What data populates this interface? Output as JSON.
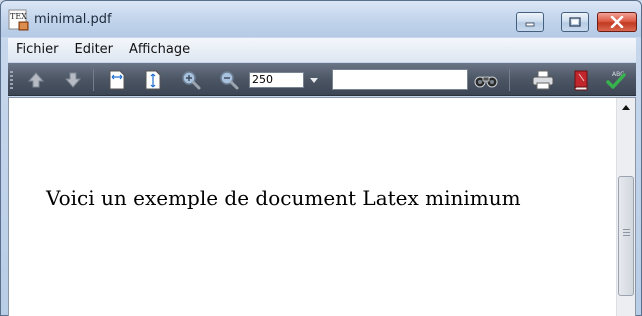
{
  "window": {
    "title": "minimal.pdf",
    "app_icon": "tex-icon"
  },
  "menu": {
    "items": [
      "Fichier",
      "Editer",
      "Affichage"
    ]
  },
  "toolbar": {
    "zoom_value": "250",
    "search_placeholder": "",
    "icons": [
      "arrow-up-icon",
      "arrow-down-icon",
      "fit-width-icon",
      "fit-height-icon",
      "zoom-in-icon",
      "zoom-out-icon",
      "find-binoculars-icon",
      "print-icon",
      "book-icon",
      "spellcheck-icon"
    ]
  },
  "document": {
    "text": "Voici un exemple de document Latex minimum"
  },
  "colors": {
    "toolbar_bg": "#4c5665",
    "close_button": "#c23a22",
    "titlebar": "#c3d5ec"
  }
}
